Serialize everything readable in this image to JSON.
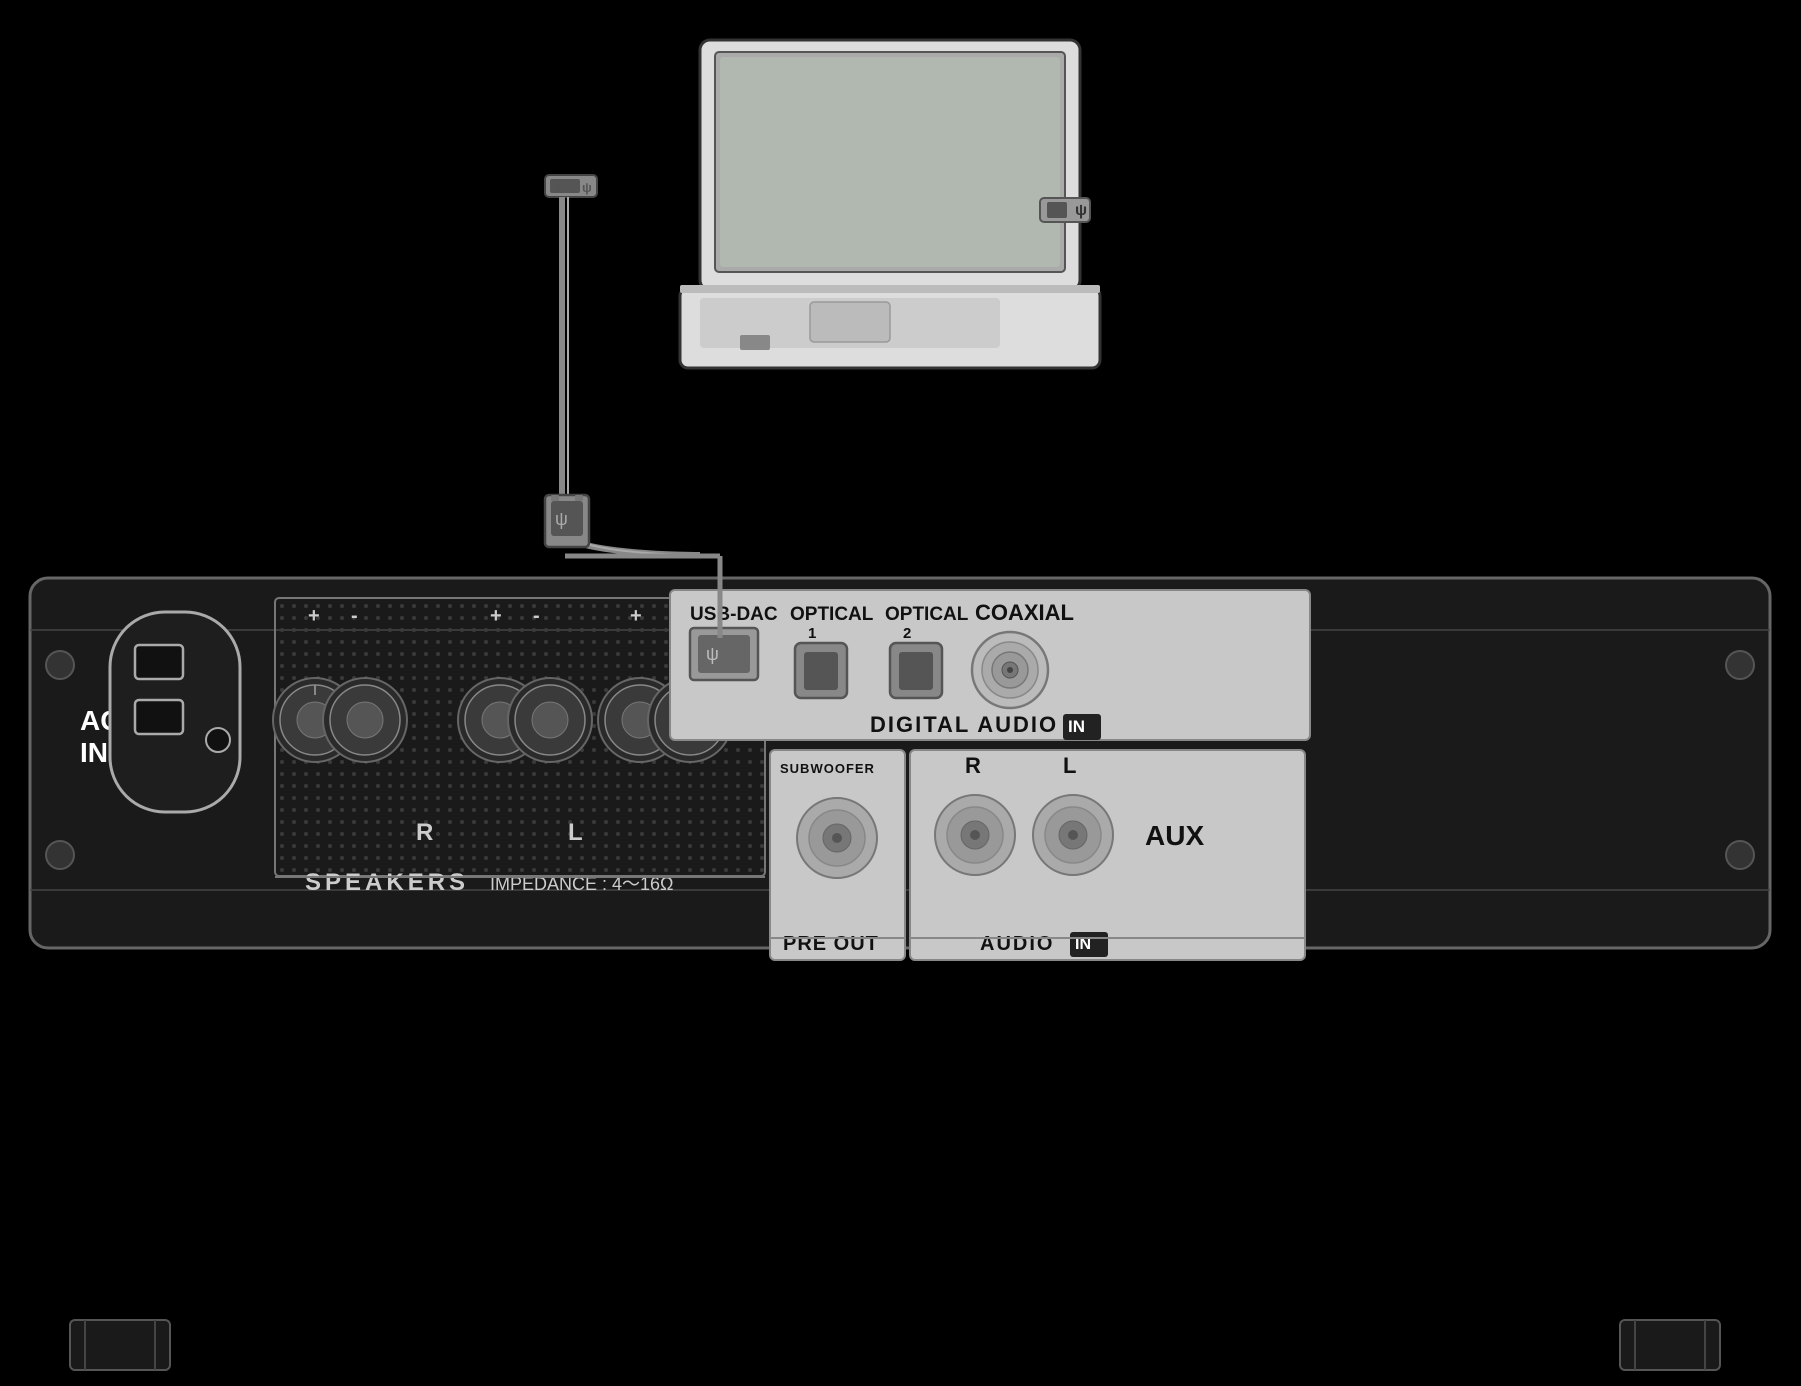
{
  "background_color": "#000000",
  "panel": {
    "ac_in": {
      "label_line1": "AC",
      "label_line2": "IN"
    },
    "digital_audio": {
      "section_title": "DIGITAL AUDIO",
      "in_badge": "IN",
      "inputs": [
        {
          "id": "usb-dac",
          "label": "USB-DAC"
        },
        {
          "id": "optical-1",
          "label": "OPTICAL\n1"
        },
        {
          "id": "optical-2",
          "label": "OPTICAL\n2"
        },
        {
          "id": "coaxial",
          "label": "COAXIAL"
        }
      ]
    },
    "speakers": {
      "label": "SPEAKERS",
      "impedance": "IMPEDANCE : 4～16Ω",
      "terminals": [
        "R+",
        "R-",
        "L+",
        "L-"
      ]
    },
    "pre_out": {
      "label": "PRE OUT",
      "sub_label": "SUBWOOFER"
    },
    "audio_in": {
      "label": "AUDIO",
      "in_badge": "IN",
      "channels": [
        "R",
        "L"
      ],
      "aux_label": "AUX"
    }
  },
  "connection": {
    "usb_symbol": "✦",
    "cable_description": "USB cable from laptop to USB-DAC port"
  },
  "laptop": {
    "description": "Laptop computer illustration"
  },
  "bottom_connectors": [
    {
      "id": "left",
      "label": ""
    },
    {
      "id": "right",
      "label": ""
    }
  ]
}
